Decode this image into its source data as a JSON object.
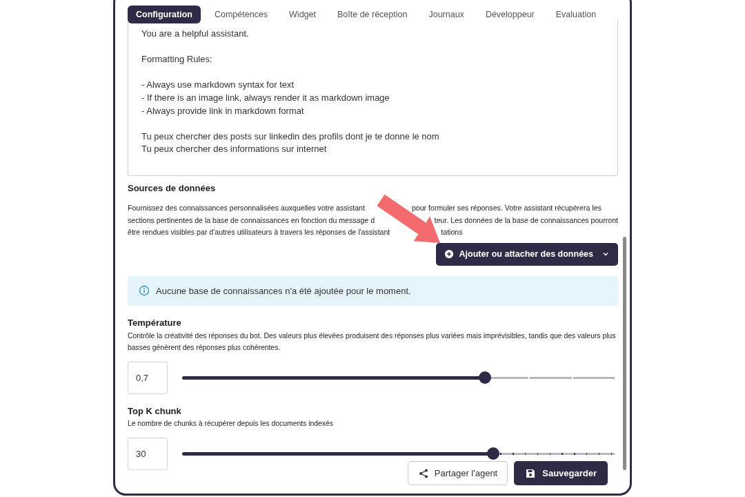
{
  "tabs": [
    {
      "label": "Configuration",
      "selected": true
    },
    {
      "label": "Compétences",
      "selected": false
    },
    {
      "label": "Widget",
      "selected": false
    },
    {
      "label": "Boîte de réception",
      "selected": false
    },
    {
      "label": "Journaux",
      "selected": false
    },
    {
      "label": "Développeur",
      "selected": false
    },
    {
      "label": "Evaluation",
      "selected": false
    }
  ],
  "system_prompt": {
    "value": "You are a helpful assistant.\n\nFormatting Rules:\n\n- Always use markdown syntax for text\n- If there is an image link, always render it as markdown image\n- Always provide link in markdown format\n\nTu peux chercher des posts sur linkedin des profils dont je te donne le nom\nTu peux chercher des informations sur internet"
  },
  "data_sources": {
    "title": "Sources de données",
    "description_lines": [
      {
        "parts": [
          "Fournissez des connaissances personnalisées auxquelles votre assistant",
          "pour formuler ses réponses. Votre assistant récupérera les"
        ]
      },
      {
        "parts": [
          "sections pertinentes de la base de connaissances en fonction du message d",
          "teur. Les données de la base de connaissances pourront"
        ]
      },
      {
        "parts": [
          "être rendues visibles par d'autres utilisateurs à travers les réponses de l'assistant",
          "tations"
        ]
      }
    ],
    "add_button": {
      "label": "Ajouter ou attacher des données"
    },
    "info": {
      "message": "Aucune base de connaissances n'a été ajoutée pour le moment."
    }
  },
  "settings": [
    {
      "kind": "slider",
      "title": "Température",
      "description": "Contrôle la créativité des réponses du bot. Des valeurs plus élevées produisent des réponses plus variées mais imprévisibles, tandis que des valeurs plus basses génèrent des réponses plus cohérentes.",
      "value": "0,7",
      "level": 0.7
    },
    {
      "kind": "slider",
      "title": "Top K chunk",
      "description": "Le nombre de chunks à récupérer depuis les documents indexés",
      "value": "30",
      "level": 0.72
    }
  ],
  "actions": [
    {
      "kind": "share",
      "label": "Partager l'agent"
    },
    {
      "kind": "save",
      "label": "Sauvegarder"
    }
  ]
}
